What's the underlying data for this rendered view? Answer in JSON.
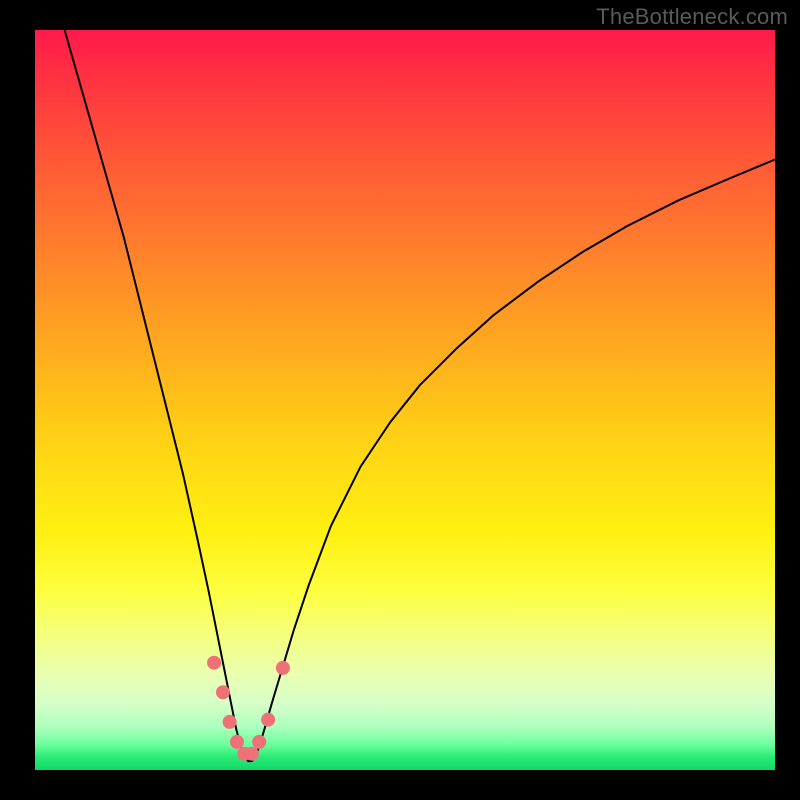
{
  "watermark": "TheBottleneck.com",
  "chart_data": {
    "type": "line",
    "title": "",
    "xlabel": "",
    "ylabel": "",
    "xlim": [
      0,
      100
    ],
    "ylim": [
      0,
      100
    ],
    "series": [
      {
        "name": "curve",
        "x": [
          4,
          6,
          8,
          10,
          12,
          14,
          16,
          18,
          20,
          22,
          23.5,
          24.7,
          25.7,
          26.5,
          27.2,
          27.8,
          28.3,
          28.8,
          29.3,
          29.8,
          30.3,
          31.0,
          32.0,
          33.5,
          35.0,
          37.0,
          40.0,
          44.0,
          48.0,
          52.0,
          57.0,
          62.0,
          68.0,
          74.0,
          80.0,
          87.0,
          94.0,
          100.0
        ],
        "values": [
          100,
          93,
          86,
          79,
          72,
          64,
          56,
          48,
          40,
          31,
          24,
          18,
          13,
          9,
          5.5,
          3.2,
          1.8,
          1.2,
          1.2,
          1.8,
          3.2,
          5.5,
          9,
          14,
          19,
          25,
          33,
          41,
          47,
          52,
          57,
          61.5,
          66,
          70,
          73.5,
          77,
          80,
          82.5
        ]
      }
    ],
    "markers": [
      {
        "x": 24.2,
        "y": 14.5
      },
      {
        "x": 25.4,
        "y": 10.5
      },
      {
        "x": 26.3,
        "y": 6.5
      },
      {
        "x": 27.3,
        "y": 3.8
      },
      {
        "x": 28.3,
        "y": 2.2
      },
      {
        "x": 29.3,
        "y": 2.2
      },
      {
        "x": 30.3,
        "y": 3.8
      },
      {
        "x": 31.5,
        "y": 6.8
      },
      {
        "x": 33.5,
        "y": 13.8
      }
    ],
    "marker_color": "#f07078",
    "curve_color": "#000000",
    "gradient_stops": [
      {
        "pos": 0.0,
        "color": "#ff1a49"
      },
      {
        "pos": 0.5,
        "color": "#ffd914"
      },
      {
        "pos": 0.82,
        "color": "#f4ff80"
      },
      {
        "pos": 1.0,
        "color": "#12d768"
      }
    ]
  }
}
